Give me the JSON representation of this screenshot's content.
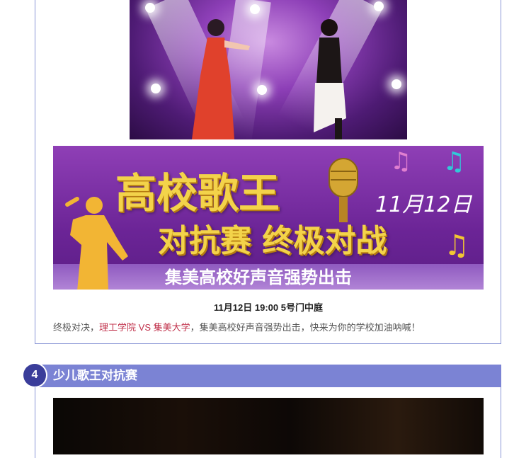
{
  "banner": {
    "title_line1": "高校歌王",
    "title_line2": "对抗赛 终极对战",
    "date": "11月12日",
    "subtitle": "集美高校好声音强势出击"
  },
  "event": {
    "time_place": "11月12日 19:00 5号门中庭"
  },
  "description": {
    "prefix": "终极对决，",
    "team_a": "理工学院",
    "vs": " VS ",
    "team_b": "集美大学",
    "suffix": "，集美高校好声音强势出击，快来为你的学校加油呐喊！"
  },
  "section4": {
    "number": "4",
    "title": "少儿歌王对抗赛"
  },
  "icons": {
    "music_note_icons": [
      "music-note-icon",
      "music-note-icon",
      "music-note-icon"
    ],
    "microphone": "microphone-icon",
    "singer_silhouette": "singer-silhouette"
  }
}
